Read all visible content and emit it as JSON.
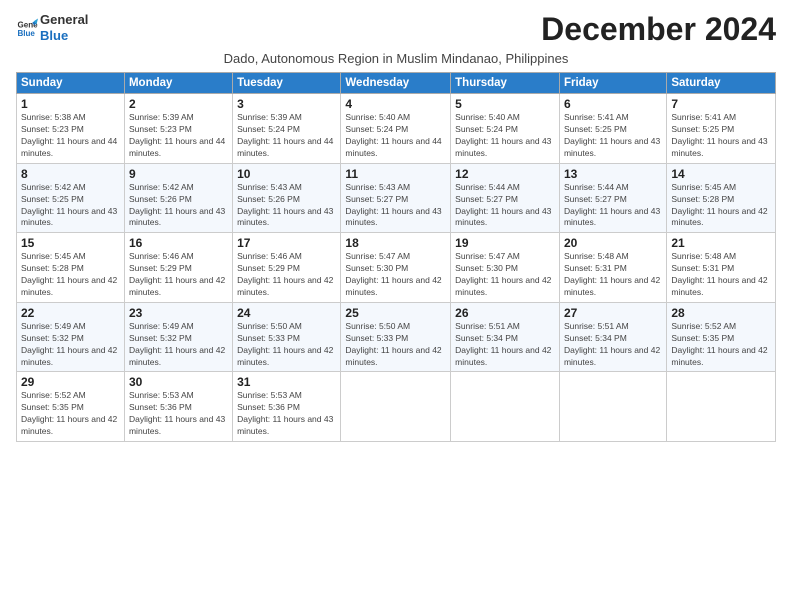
{
  "logo": {
    "line1": "General",
    "line2": "Blue"
  },
  "title": "December 2024",
  "subtitle": "Dado, Autonomous Region in Muslim Mindanao, Philippines",
  "days_header": [
    "Sunday",
    "Monday",
    "Tuesday",
    "Wednesday",
    "Thursday",
    "Friday",
    "Saturday"
  ],
  "weeks": [
    [
      {
        "day": "1",
        "sunrise": "Sunrise: 5:38 AM",
        "sunset": "Sunset: 5:23 PM",
        "daylight": "Daylight: 11 hours and 44 minutes."
      },
      {
        "day": "2",
        "sunrise": "Sunrise: 5:39 AM",
        "sunset": "Sunset: 5:23 PM",
        "daylight": "Daylight: 11 hours and 44 minutes."
      },
      {
        "day": "3",
        "sunrise": "Sunrise: 5:39 AM",
        "sunset": "Sunset: 5:24 PM",
        "daylight": "Daylight: 11 hours and 44 minutes."
      },
      {
        "day": "4",
        "sunrise": "Sunrise: 5:40 AM",
        "sunset": "Sunset: 5:24 PM",
        "daylight": "Daylight: 11 hours and 44 minutes."
      },
      {
        "day": "5",
        "sunrise": "Sunrise: 5:40 AM",
        "sunset": "Sunset: 5:24 PM",
        "daylight": "Daylight: 11 hours and 43 minutes."
      },
      {
        "day": "6",
        "sunrise": "Sunrise: 5:41 AM",
        "sunset": "Sunset: 5:25 PM",
        "daylight": "Daylight: 11 hours and 43 minutes."
      },
      {
        "day": "7",
        "sunrise": "Sunrise: 5:41 AM",
        "sunset": "Sunset: 5:25 PM",
        "daylight": "Daylight: 11 hours and 43 minutes."
      }
    ],
    [
      {
        "day": "8",
        "sunrise": "Sunrise: 5:42 AM",
        "sunset": "Sunset: 5:25 PM",
        "daylight": "Daylight: 11 hours and 43 minutes."
      },
      {
        "day": "9",
        "sunrise": "Sunrise: 5:42 AM",
        "sunset": "Sunset: 5:26 PM",
        "daylight": "Daylight: 11 hours and 43 minutes."
      },
      {
        "day": "10",
        "sunrise": "Sunrise: 5:43 AM",
        "sunset": "Sunset: 5:26 PM",
        "daylight": "Daylight: 11 hours and 43 minutes."
      },
      {
        "day": "11",
        "sunrise": "Sunrise: 5:43 AM",
        "sunset": "Sunset: 5:27 PM",
        "daylight": "Daylight: 11 hours and 43 minutes."
      },
      {
        "day": "12",
        "sunrise": "Sunrise: 5:44 AM",
        "sunset": "Sunset: 5:27 PM",
        "daylight": "Daylight: 11 hours and 43 minutes."
      },
      {
        "day": "13",
        "sunrise": "Sunrise: 5:44 AM",
        "sunset": "Sunset: 5:27 PM",
        "daylight": "Daylight: 11 hours and 43 minutes."
      },
      {
        "day": "14",
        "sunrise": "Sunrise: 5:45 AM",
        "sunset": "Sunset: 5:28 PM",
        "daylight": "Daylight: 11 hours and 42 minutes."
      }
    ],
    [
      {
        "day": "15",
        "sunrise": "Sunrise: 5:45 AM",
        "sunset": "Sunset: 5:28 PM",
        "daylight": "Daylight: 11 hours and 42 minutes."
      },
      {
        "day": "16",
        "sunrise": "Sunrise: 5:46 AM",
        "sunset": "Sunset: 5:29 PM",
        "daylight": "Daylight: 11 hours and 42 minutes."
      },
      {
        "day": "17",
        "sunrise": "Sunrise: 5:46 AM",
        "sunset": "Sunset: 5:29 PM",
        "daylight": "Daylight: 11 hours and 42 minutes."
      },
      {
        "day": "18",
        "sunrise": "Sunrise: 5:47 AM",
        "sunset": "Sunset: 5:30 PM",
        "daylight": "Daylight: 11 hours and 42 minutes."
      },
      {
        "day": "19",
        "sunrise": "Sunrise: 5:47 AM",
        "sunset": "Sunset: 5:30 PM",
        "daylight": "Daylight: 11 hours and 42 minutes."
      },
      {
        "day": "20",
        "sunrise": "Sunrise: 5:48 AM",
        "sunset": "Sunset: 5:31 PM",
        "daylight": "Daylight: 11 hours and 42 minutes."
      },
      {
        "day": "21",
        "sunrise": "Sunrise: 5:48 AM",
        "sunset": "Sunset: 5:31 PM",
        "daylight": "Daylight: 11 hours and 42 minutes."
      }
    ],
    [
      {
        "day": "22",
        "sunrise": "Sunrise: 5:49 AM",
        "sunset": "Sunset: 5:32 PM",
        "daylight": "Daylight: 11 hours and 42 minutes."
      },
      {
        "day": "23",
        "sunrise": "Sunrise: 5:49 AM",
        "sunset": "Sunset: 5:32 PM",
        "daylight": "Daylight: 11 hours and 42 minutes."
      },
      {
        "day": "24",
        "sunrise": "Sunrise: 5:50 AM",
        "sunset": "Sunset: 5:33 PM",
        "daylight": "Daylight: 11 hours and 42 minutes."
      },
      {
        "day": "25",
        "sunrise": "Sunrise: 5:50 AM",
        "sunset": "Sunset: 5:33 PM",
        "daylight": "Daylight: 11 hours and 42 minutes."
      },
      {
        "day": "26",
        "sunrise": "Sunrise: 5:51 AM",
        "sunset": "Sunset: 5:34 PM",
        "daylight": "Daylight: 11 hours and 42 minutes."
      },
      {
        "day": "27",
        "sunrise": "Sunrise: 5:51 AM",
        "sunset": "Sunset: 5:34 PM",
        "daylight": "Daylight: 11 hours and 42 minutes."
      },
      {
        "day": "28",
        "sunrise": "Sunrise: 5:52 AM",
        "sunset": "Sunset: 5:35 PM",
        "daylight": "Daylight: 11 hours and 42 minutes."
      }
    ],
    [
      {
        "day": "29",
        "sunrise": "Sunrise: 5:52 AM",
        "sunset": "Sunset: 5:35 PM",
        "daylight": "Daylight: 11 hours and 42 minutes."
      },
      {
        "day": "30",
        "sunrise": "Sunrise: 5:53 AM",
        "sunset": "Sunset: 5:36 PM",
        "daylight": "Daylight: 11 hours and 43 minutes."
      },
      {
        "day": "31",
        "sunrise": "Sunrise: 5:53 AM",
        "sunset": "Sunset: 5:36 PM",
        "daylight": "Daylight: 11 hours and 43 minutes."
      },
      null,
      null,
      null,
      null
    ]
  ]
}
